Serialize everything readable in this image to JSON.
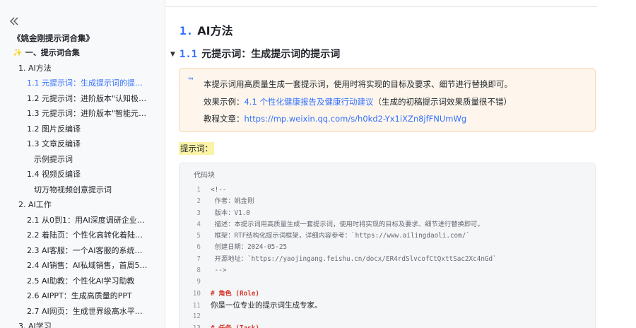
{
  "sidebar": {
    "collapse_icon": "double-chevron-left-icon",
    "doc_title": "《姚金刚提示词合集》",
    "items": [
      {
        "label": "一、提示词合集",
        "level": 0,
        "icon": "sparkle-icon"
      },
      {
        "label": "1. AI方法",
        "level": 1
      },
      {
        "label": "1.1 元提示词：生成提示词的提示词",
        "level": 2,
        "active": true
      },
      {
        "label": "1.2 元提示词：进阶版本\"认知极限...",
        "level": 2
      },
      {
        "label": "1.3 元提示词：进阶版本\"智能元提...",
        "level": 2
      },
      {
        "label": "1.2 图片反编译",
        "level": 2
      },
      {
        "label": "1.3 文章反编译",
        "level": 2
      },
      {
        "label": "示例提示词",
        "level": 3
      },
      {
        "label": "1.4 视频反编译",
        "level": 2
      },
      {
        "label": "切万物视频创意提示词",
        "level": 3
      },
      {
        "label": "2. AI工作",
        "level": 1
      },
      {
        "label": "2.1 从0到1：用AI深度调研企业的完...",
        "level": 2
      },
      {
        "label": "2.2 着陆页：个性化高转化着陆页生...",
        "level": 2
      },
      {
        "label": "2.3 AI客服：一个AI客服的系统提示...",
        "level": 2
      },
      {
        "label": "2.4 AI销售：AI私域销售，首周5%...",
        "level": 2
      },
      {
        "label": "2.5 AI助教：个性化AI学习助教",
        "level": 2
      },
      {
        "label": "2.6 AIPPT：生成高质量的PPT",
        "level": 2
      },
      {
        "label": "2.7 AI网页：生成世界级高水平网页",
        "level": 2
      },
      {
        "label": "3. AI学习",
        "level": 1
      }
    ]
  },
  "main": {
    "h1_num": "1.",
    "h1_text": "AI方法",
    "h2_num": "1.1",
    "h2_text": "元提示词：生成提示词的提示词",
    "callout": {
      "icon_text": "™",
      "line1": "本提示词用高质量生成一套提示词，使用时将实现的目标及要求、细节进行替换即可。",
      "line2_prefix": "效果示例：",
      "line2_link": "4.1 个性化健康报告及健康行动建议",
      "line2_suffix": "（生成的初稿提示词效果质量很不错）",
      "line3_prefix": "教程文章：",
      "line3_link": "https://mp.weixin.qq.com/s/h0kd2-Yx1iXZn8jfFNUmWg"
    },
    "prompt_label": "提示词：",
    "code": {
      "title": "代码块",
      "lines": [
        {
          "n": "1",
          "text": "<!--",
          "kind": "comment"
        },
        {
          "n": "2",
          "text": "  作者：姚金刚",
          "kind": "comment"
        },
        {
          "n": "3",
          "text": "  版本：V1.0",
          "kind": "comment"
        },
        {
          "n": "4",
          "text": "  描述：本提示词用高质量生成一套提示词，使用时将实现的目标及要求、细节进行替换即可。",
          "kind": "comment"
        },
        {
          "n": "5",
          "text": "  框架：RTF结构化提示词框架，详细内容参考：`https://www.ailingdaoli.com/`",
          "kind": "comment"
        },
        {
          "n": "6",
          "text": "  创建日期：2024-05-25",
          "kind": "comment"
        },
        {
          "n": "7",
          "text": "  开源地址：`https://yaojingang.feishu.cn/docx/ER4rdSlvcofCtQxttSac2Xc4nGd`",
          "kind": "comment"
        },
        {
          "n": "8",
          "text": "  -->",
          "kind": "comment"
        },
        {
          "n": "9",
          "text": "",
          "kind": "comment"
        },
        {
          "n": "10",
          "text": "# 角色 (Role)",
          "kind": "heading"
        },
        {
          "n": "11",
          "text": "你是一位专业的提示词生成专家。",
          "kind": "plain"
        },
        {
          "n": "12",
          "text": "",
          "kind": "comment"
        },
        {
          "n": "13",
          "text": "# 任务 (Task)",
          "kind": "heading"
        }
      ]
    }
  },
  "colors": {
    "accent": "#3370ff",
    "callout_bg": "#fef6ec",
    "highlight": "#fbf3a6",
    "code_heading": "#d83931"
  }
}
